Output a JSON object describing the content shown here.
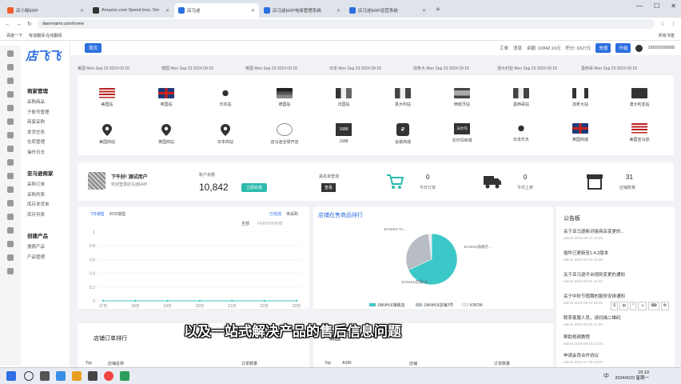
{
  "browser": {
    "tabs": [
      {
        "label": "店小秘ERP",
        "active": false
      },
      {
        "label": "Amazon.com Spend less. Sm",
        "active": false
      },
      {
        "label": "店马迷",
        "active": true
      },
      {
        "label": "店马迷ERP电商管理系统",
        "active": false
      },
      {
        "label": "店马迷ERP运营系统",
        "active": false
      }
    ],
    "new_tab": "+",
    "window_controls": [
      "—",
      "☐",
      "✕"
    ],
    "url": "dianmaimi.com/home",
    "bookmarks": [
      "百度一下",
      "有道翻译-在线翻译"
    ],
    "bookmarks_right": "所有书签"
  },
  "sidebar": {
    "logo": "店飞飞",
    "groups": [
      {
        "title": "商家管理",
        "items": [
          "采购商品",
          "子账号管理",
          "商家采购",
          "发货任务",
          "仓库管理",
          "操作日志"
        ]
      },
      {
        "title": "亚马逊商家",
        "items": [
          "采购订单",
          "采购列表",
          "库存发货单",
          "库存列表"
        ]
      },
      {
        "title": "创建产品",
        "items": [
          "搜索产品",
          "产品管理"
        ]
      }
    ]
  },
  "topbar": {
    "breadcrumb": "首页",
    "work_label": "工单",
    "msg_label": "消息",
    "balance_text": "余额: 10842.16元",
    "points_text": "积分: 6327元",
    "recharge_btn": "充值",
    "vip_btn": "升级",
    "phone": "18899998888"
  },
  "times": [
    "美国 Mon Sep 23 2024 09:18",
    "德国 Mon Sep 23 2024 09:18",
    "英国 Mon Sep 23 2024 09:18",
    "日本 Mon Sep 23 2024 09:18",
    "加拿大 Mon Sep 23 2024 09:18",
    "澳大利亚 Mon Sep 23 2024 09:18",
    "墨西哥 Mon Sep 23 2024 09:18"
  ],
  "sites_row1": [
    "美国站",
    "英国站",
    "日本站",
    "德国站",
    "法国站",
    "意大利站",
    "西班牙站",
    "墨西哥站",
    "加拿大站",
    "澳大利亚站"
  ],
  "sites_row2": [
    "美国商站",
    "英国商站",
    "日本商站",
    "店马迷全球开店",
    "1688",
    "谷歌商城",
    "沃尔玛商城",
    "日本乐天",
    "英国商城",
    "美国亚马逊"
  ],
  "sites_row2_badges": {
    "1688": "1688",
    "walmart": "沃尔玛"
  },
  "stats": {
    "greeting": "下午好! 测试用户",
    "greeting_sub": "欢迎登录店马迷ERP",
    "balance_label": "账户余额",
    "balance_value": "10,842",
    "recharge": "立即充值",
    "blacklist_label": "黑名单查询",
    "blacklist_btn": "查看",
    "items": [
      {
        "value": "0",
        "label": "今日订单"
      },
      {
        "value": "0",
        "label": "今日上架"
      },
      {
        "value": "31",
        "label": "店铺数量"
      }
    ]
  },
  "chart_card": {
    "tabs": [
      "7日销售",
      "30日销售"
    ],
    "right": [
      "已完成",
      "待采购"
    ],
    "legend": [
      "全部",
      "FBA/FBM全部"
    ]
  },
  "chart_data": [
    {
      "type": "line",
      "x": [
        "17日",
        "18日",
        "19日",
        "20日",
        "21日",
        "22日",
        "23日"
      ],
      "series": [
        {
          "values": [
            0,
            0,
            0,
            0,
            0,
            0,
            0
          ]
        }
      ],
      "ylim": [
        0,
        1
      ],
      "yticks": [
        "0",
        "0.2",
        "0.4",
        "0.6",
        "0.8",
        "1"
      ],
      "title": "",
      "xlabel": "",
      "ylabel": ""
    },
    {
      "type": "pie",
      "title": "店铺在售商品排行",
      "categories": [
        "JIANHUI旗舰店",
        "JIANHUI店铺2号",
        "KINTAI"
      ],
      "values": [
        68,
        30,
        2
      ],
      "colors": [
        "#3cc8c8",
        "#b8bcc4",
        "#e8e8e8"
      ]
    }
  ],
  "pie_labels": [
    "JIANHUI-TA...",
    "JIANHUI旗舰店 ...",
    "JIANHUI店铺2号..."
  ],
  "notice": {
    "title": "公告板",
    "items": [
      {
        "text": "关于亚马逊新对接商店变更的...",
        "meta": "admin 2024-09-13 10:20"
      },
      {
        "text": "插件已更新至1.4.2版本",
        "meta": "admin 2024-09-10 15:58"
      },
      {
        "text": "关于亚马逊平台规则变更的通知",
        "meta": "admin 2024-09-05 10:43"
      },
      {
        "text": "关于中秋节假期的服务安排通知",
        "meta": "admin 2024-09-01 09:26"
      },
      {
        "text": "联系客服人员，请扫描二维码",
        "meta": "admin 2024-08-25 11:20"
      },
      {
        "text": "帮助视频教程",
        "meta": "admin 2024-08-10 14:33"
      },
      {
        "text": "申请会员合作协议",
        "meta": "admin 2024-07-28 16:05"
      }
    ]
  },
  "rank1": {
    "title": "店铺订单排行",
    "headers": [
      "Top",
      "店铺名称",
      "订单数量"
    ]
  },
  "rank2": {
    "title": "商品",
    "headers": [
      "Top",
      "ASIN",
      "店铺",
      "订单数量"
    ]
  },
  "subtitle": "以及一站式解决产品的售后信息问题",
  "float_tools": [
    "S",
    "中",
    "°",
    "☺",
    "⌨",
    "⚙"
  ],
  "taskbar": {
    "time": "15:10",
    "date": "2024/9/23 星期一",
    "tray": "中"
  }
}
